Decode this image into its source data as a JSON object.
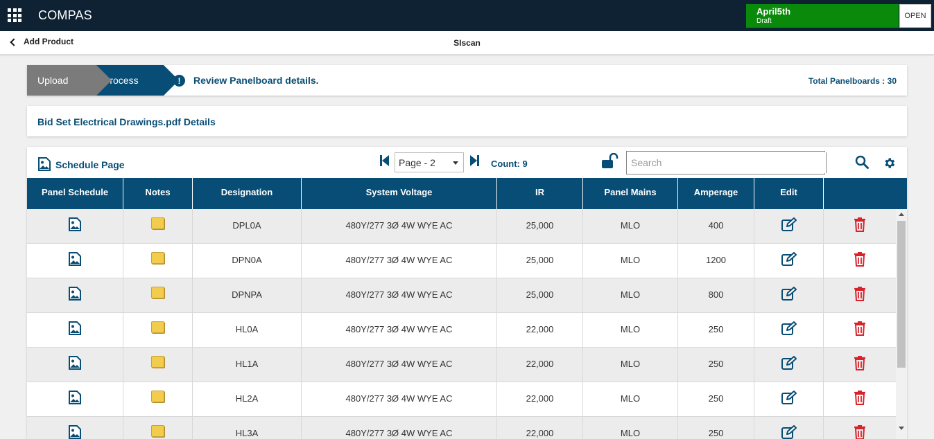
{
  "app": {
    "title": "COMPAS"
  },
  "project": {
    "name": "April5th",
    "status": "Draft",
    "open_label": "OPEN"
  },
  "subheader": {
    "back_label": "Add Product",
    "title": "SIscan"
  },
  "steps": {
    "upload": "Upload",
    "process": "Process",
    "message": "Review Panelboard details.",
    "total": "Total Panelboards : 30"
  },
  "file": {
    "title": "Bid Set Electrical Drawings.pdf Details"
  },
  "schedule": {
    "title": "Schedule Page",
    "page_label": "Page - 2",
    "count": "Count: 9",
    "search_placeholder": "Search"
  },
  "table": {
    "headers": [
      "Panel Schedule",
      "Notes",
      "Designation",
      "System Voltage",
      "IR",
      "Panel Mains",
      "Amperage",
      "Edit",
      ""
    ],
    "rows": [
      {
        "designation": "DPL0A",
        "voltage": "480Y/277 3Ø 4W WYE AC",
        "ir": "25,000",
        "mains": "MLO",
        "amperage": "400"
      },
      {
        "designation": "DPN0A",
        "voltage": "480Y/277 3Ø 4W WYE AC",
        "ir": "25,000",
        "mains": "MLO",
        "amperage": "1200"
      },
      {
        "designation": "DPNPA",
        "voltage": "480Y/277 3Ø 4W WYE AC",
        "ir": "25,000",
        "mains": "MLO",
        "amperage": "800"
      },
      {
        "designation": "HL0A",
        "voltage": "480Y/277 3Ø 4W WYE AC",
        "ir": "22,000",
        "mains": "MLO",
        "amperage": "250"
      },
      {
        "designation": "HL1A",
        "voltage": "480Y/277 3Ø 4W WYE AC",
        "ir": "22,000",
        "mains": "MLO",
        "amperage": "250"
      },
      {
        "designation": "HL2A",
        "voltage": "480Y/277 3Ø 4W WYE AC",
        "ir": "22,000",
        "mains": "MLO",
        "amperage": "250"
      },
      {
        "designation": "HL3A",
        "voltage": "480Y/277 3Ø 4W WYE AC",
        "ir": "22,000",
        "mains": "MLO",
        "amperage": "250"
      }
    ]
  },
  "colors": {
    "navy": "#084d75",
    "topbar": "#0f2233",
    "project_green": "#0a8a0a",
    "delete_red": "#d9232b",
    "step_grey": "#7b7b7b"
  },
  "icons": {
    "apps": "apps-grid-icon",
    "back": "chevron-left-icon",
    "alert": "exclamation-circle-icon",
    "image": "image-icon",
    "note": "sticky-note-icon",
    "edit": "edit-icon",
    "delete": "trash-icon",
    "first": "skip-first-icon",
    "last": "skip-last-icon",
    "lock": "unlock-icon",
    "search": "search-icon",
    "settings": "gear-icon"
  }
}
